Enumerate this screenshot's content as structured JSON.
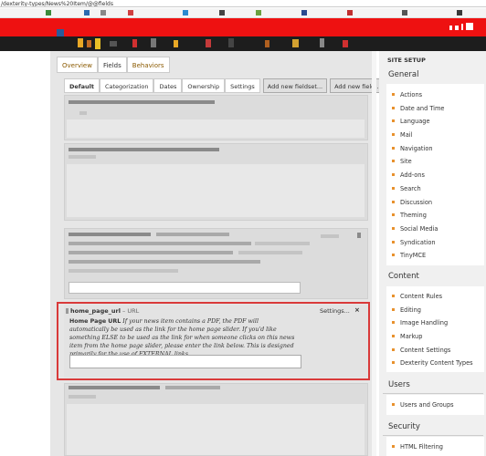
{
  "browser": {
    "url": "/dexterity-types/News%20Item/@@fields"
  },
  "tabs": {
    "top": [
      "Overview",
      "Fields",
      "Behaviors"
    ],
    "fieldsets": [
      "Default",
      "Categorization",
      "Dates",
      "Ownership",
      "Settings"
    ],
    "add_fieldset_button": "Add new fieldset...",
    "add_field_button": "Add new field..."
  },
  "field": {
    "name": "home_page_url",
    "type": "– URL",
    "settings_label": "Settings...",
    "close_label": "×",
    "title": "Home Page URL",
    "description": "If your news item contains a PDF, the PDF will automatically be used as the link for the home page slider. If you'd like something ELSE to be used as the link for when someone clicks on this news item from the home page slider, please enter the link below. This is designed primarily for the use of EXTERNAL links.",
    "value": ""
  },
  "sidebar": {
    "title": "SITE SETUP",
    "general": {
      "heading": "General",
      "items": [
        "Actions",
        "Date and Time",
        "Language",
        "Mail",
        "Navigation",
        "Site",
        "Add-ons",
        "Search",
        "Discussion",
        "Theming",
        "Social Media",
        "Syndication",
        "TinyMCE"
      ]
    },
    "content": {
      "heading": "Content",
      "items": [
        "Content Rules",
        "Editing",
        "Image Handling",
        "Markup",
        "Content Settings",
        "Dexterity Content Types"
      ]
    },
    "users": {
      "heading": "Users",
      "items": [
        "Users and Groups"
      ]
    },
    "security": {
      "heading": "Security",
      "items": [
        "HTML Filtering"
      ]
    }
  },
  "colors": {
    "header": "#ee1111",
    "highlight": "#d93a3a",
    "bullet": "#e8912d",
    "tab_text": "#8b5a00"
  }
}
